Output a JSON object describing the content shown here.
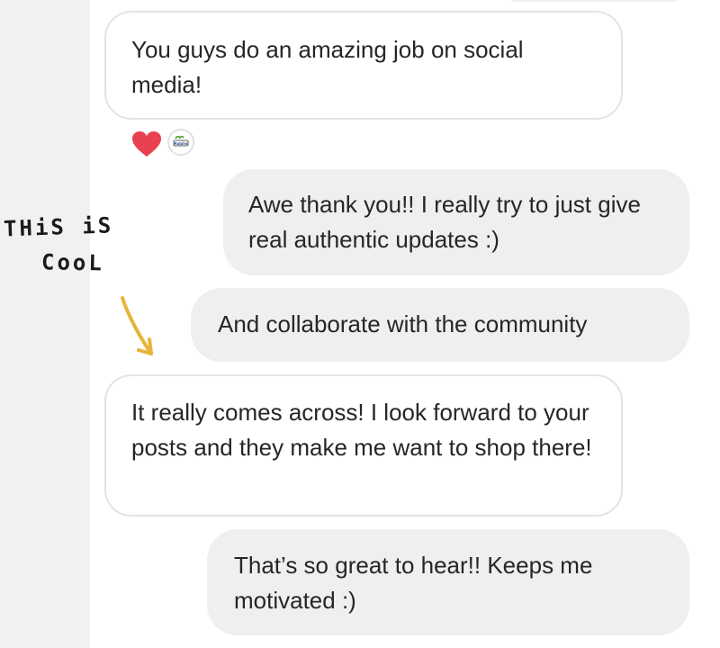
{
  "conversation": {
    "messages": [
      {
        "sender": "them",
        "text": "You guys do an amazing job on social media!"
      },
      {
        "sender": "me",
        "text": "Awe thank you!! I really try to just give real authentic updates :)"
      },
      {
        "sender": "me",
        "text": "And collaborate with the community"
      },
      {
        "sender": "them",
        "text": "It really comes across! I look forward to your posts and they make me want to shop there!"
      },
      {
        "sender": "me",
        "text": "That’s so great to hear!! Keeps me motivated :)"
      }
    ],
    "reaction": {
      "emoji": "heart-icon",
      "color": "#e8414f",
      "reactor_avatar_text": "Ralph's"
    }
  },
  "annotation": {
    "line1": "THiS  iS",
    "line2": "CooL",
    "arrow_icon": "arrow-down-right-icon",
    "arrow_color": "#e6b53a"
  },
  "colors": {
    "received_bubble": "#ffffff",
    "received_border": "#e4e4e4",
    "sent_bubble": "#efefef",
    "text": "#262626"
  }
}
